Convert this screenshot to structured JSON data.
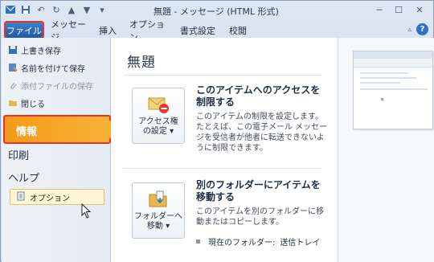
{
  "window": {
    "title": "無題 - メッセージ (HTML 形式)"
  },
  "ribbon": {
    "tabs": [
      {
        "label": "ファイル"
      },
      {
        "label": "メッセージ"
      },
      {
        "label": "挿入"
      },
      {
        "label": "オプション"
      },
      {
        "label": "書式設定"
      },
      {
        "label": "校閲"
      }
    ]
  },
  "nav": {
    "save": "上書き保存",
    "save_as": "名前を付けて保存",
    "save_attachments": "添付ファイルの保存",
    "close": "閉じる",
    "info": "情報",
    "print": "印刷",
    "help": "ヘルプ",
    "options": "オプション"
  },
  "main": {
    "title": "無題",
    "access": {
      "button_line1": "アクセス権",
      "button_line2": "の設定",
      "heading": "このアイテムへのアクセスを制限する",
      "description": "このアイテムの制限を設定します。たとえば、この電子メール メッセージを受信者が他者に転送できないように制限できます。"
    },
    "move": {
      "button_line1": "フォルダーへ",
      "button_line2": "移動",
      "heading": "別のフォルダーにアイテムを移動する",
      "description": "このアイテムを別のフォルダーに移動またはコピーします。",
      "current_folder_label": "現在のフォルダー:",
      "current_folder_value": "送信トレイ"
    }
  },
  "colors": {
    "accent_orange": "#f49a1a",
    "file_tab_blue": "#1f59a5",
    "highlight_red": "#e0352b"
  }
}
